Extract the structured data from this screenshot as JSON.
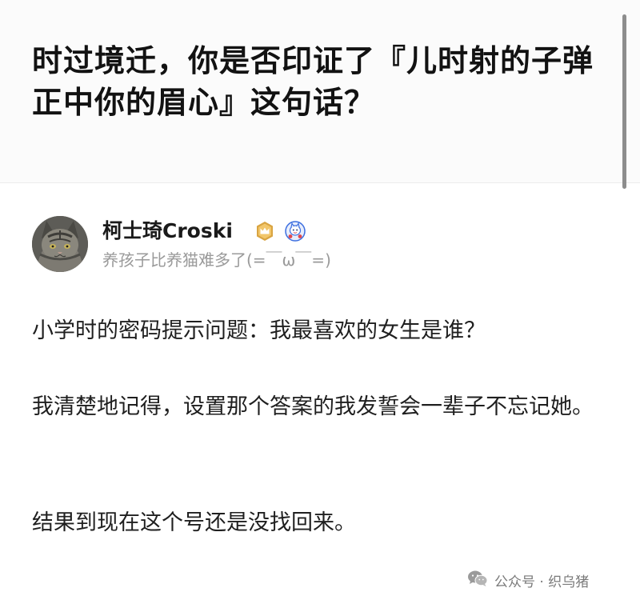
{
  "question": {
    "title": "时过境迁，你是否印证了『儿时射的子弹正中你的眉心』这句话？"
  },
  "author": {
    "name": "柯士琦Croski",
    "bio": "养孩子比养猫难多了(=￣ω￣=)",
    "avatar_icon": "cat-avatar-icon",
    "badges": [
      "gold-crown-badge-icon",
      "blue-mascot-badge-icon"
    ]
  },
  "answer": {
    "paragraphs": [
      "小学时的密码提示问题：我最喜欢的女生是谁？",
      "我清楚地记得，设置那个答案的我发誓会一辈子不忘记她。",
      "结果到现在这个号还是没找回来。"
    ]
  },
  "watermark": {
    "icon": "wechat-icon",
    "text": "公众号 · 织乌猪"
  },
  "colors": {
    "title": "#121212",
    "body_text": "#1f1f1f",
    "bio_text": "#9a9a9a",
    "badge_gold": "#d9a441",
    "badge_blue": "#3d6fe0",
    "header_bg": "#fbfbfb"
  }
}
